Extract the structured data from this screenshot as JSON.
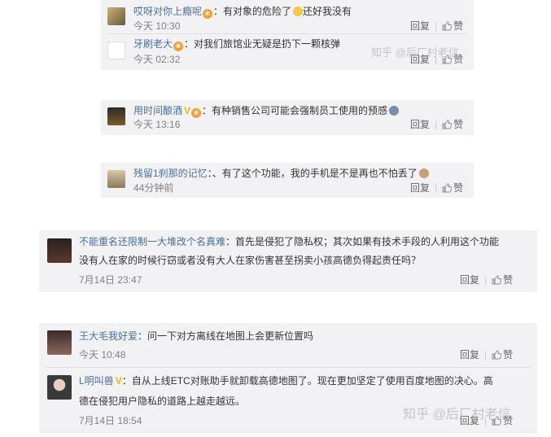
{
  "card1": {
    "c1": {
      "user": "哎呀对你上瘾呢",
      "text": "：有对象的危险了",
      "text2": "还好我没有",
      "time": "今天 10:30"
    },
    "c2": {
      "user": "牙刷老大",
      "text": "：对我们旅馆业无疑是扔下一颗核弹",
      "time": "今天 02:32"
    }
  },
  "card2": {
    "user": "用时间酿酒",
    "text": "：有种销售公司可能会强制员工使用的预感",
    "time": "今天 13:16"
  },
  "card3": {
    "user": "残留1刹那的记忆",
    "text": "：、有了这个功能，我的手机是不是再也不怕丢了",
    "time": "44分钟前"
  },
  "card4": {
    "user": "不能重名还限制一大堆改个名真难",
    "line1_text": "：首先是侵犯了隐私权；其次如果有技术手段的人利用这个功能",
    "line2_text": "没有人在家的时候行窃或者没有大人在家伤害甚至拐卖小孩高德负得起责任吗？",
    "time": "7月14日 23:47"
  },
  "card5": {
    "c1": {
      "user": "王大毛我好爱",
      "text": "：问一下对方离线在地图上会更新位置吗",
      "time": "今天 10:48"
    },
    "c2": {
      "user": "L明叫兽",
      "line1_text": "：自从上线ETC对账助手就卸载高德地图了。现在更加坚定了使用百度地图的决心。高",
      "line2_text": "德在侵犯用户隐私的道路上越走越远。",
      "time": "7月14日 18:54"
    }
  },
  "labels": {
    "reply": "回复",
    "like": "赞"
  },
  "watermark": "知乎 @后厂村老信",
  "colors": {
    "username": "#4a6f9c",
    "time": "#808080",
    "card_bg": "#f2f2f5",
    "badge": "#f3a03a"
  }
}
